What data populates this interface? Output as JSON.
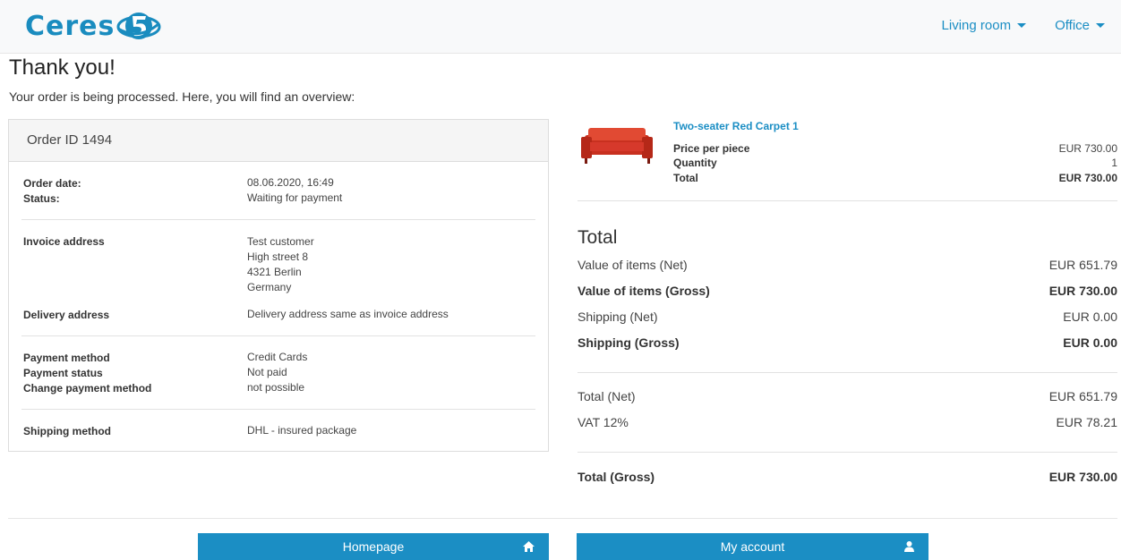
{
  "header": {
    "logo_text": "Ceres",
    "nav": [
      {
        "label": "Living room"
      },
      {
        "label": "Office"
      }
    ]
  },
  "page": {
    "title": "Thank you!",
    "subtitle": "Your order is being processed. Here, you will find an overview:"
  },
  "order": {
    "id_label": "Order ID 1494",
    "order_date_label": "Order date:",
    "order_date": "08.06.2020, 16:49",
    "status_label": "Status:",
    "status": "Waiting for payment",
    "invoice_label": "Invoice address",
    "invoice_lines": [
      "Test customer",
      "High street 8",
      "4321 Berlin",
      "Germany"
    ],
    "delivery_label": "Delivery address",
    "delivery": "Delivery address same as invoice address",
    "payment_method_label": "Payment method",
    "payment_method": "Credit Cards",
    "payment_status_label": "Payment status",
    "payment_status": "Not paid",
    "change_payment_label": "Change payment method",
    "change_payment": "not possible",
    "shipping_method_label": "Shipping method",
    "shipping_method": "DHL - insured package"
  },
  "product": {
    "name": "Two-seater Red Carpet 1",
    "price_label": "Price per piece",
    "price": "EUR 730.00",
    "quantity_label": "Quantity",
    "quantity": "1",
    "total_label": "Total",
    "total": "EUR 730.00"
  },
  "totals": {
    "title": "Total",
    "items_net_label": "Value of items (Net)",
    "items_net": "EUR 651.79",
    "items_gross_label": "Value of items (Gross)",
    "items_gross": "EUR 730.00",
    "shipping_net_label": "Shipping (Net)",
    "shipping_net": "EUR 0.00",
    "shipping_gross_label": "Shipping (Gross)",
    "shipping_gross": "EUR 0.00",
    "total_net_label": "Total (Net)",
    "total_net": "EUR 651.79",
    "vat_label": "VAT 12%",
    "vat": "EUR 78.21",
    "total_gross_label": "Total (Gross)",
    "total_gross": "EUR 730.00"
  },
  "buttons": {
    "homepage": "Homepage",
    "my_account": "My account"
  },
  "colors": {
    "accent": "#1b8ec4",
    "logo": "#1a8cbf",
    "product_red": "#d6392b"
  },
  "icons": {
    "home": "home-icon",
    "account": "user-icon",
    "caret": "caret-down-icon"
  }
}
